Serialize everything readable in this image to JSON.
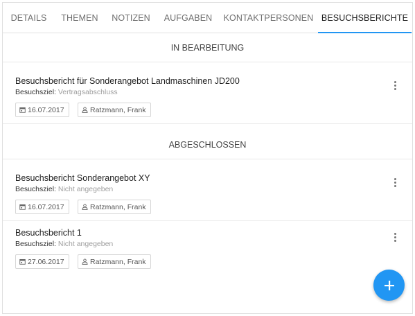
{
  "tabs": [
    {
      "label": "Details"
    },
    {
      "label": "Themen"
    },
    {
      "label": "Notizen"
    },
    {
      "label": "Aufgaben"
    },
    {
      "label": "Kontaktpersonen"
    },
    {
      "label": "Besuchsberichte",
      "active": true
    }
  ],
  "sections": {
    "in_progress": {
      "title": "In Bearbeitung",
      "reports": [
        {
          "title": "Besuchsbericht für Sonderangebot Landmaschinen JD200",
          "goal_label": "Besuchsziel:",
          "goal_value": "Vertragsabschluss",
          "date": "16.07.2017",
          "person": "Ratzmann, Frank"
        }
      ]
    },
    "completed": {
      "title": "Abgeschlossen",
      "reports": [
        {
          "title": "Besuchsbericht Sonderangebot XY",
          "goal_label": "Besuchsziel:",
          "goal_value": "Nicht angegeben",
          "date": "16.07.2017",
          "person": "Ratzmann, Frank"
        },
        {
          "title": "Besuchsbericht 1",
          "goal_label": "Besuchsziel:",
          "goal_value": "Nicht angegeben",
          "date": "27.06.2017",
          "person": "Ratzmann, Frank"
        }
      ]
    }
  },
  "colors": {
    "accent": "#2196f3",
    "text_primary": "#212121",
    "text_muted": "#9e9e9e"
  },
  "icons": {
    "date": "calendar-icon",
    "person": "person-icon",
    "menu": "more-vert-icon",
    "fab": "plus-icon"
  }
}
